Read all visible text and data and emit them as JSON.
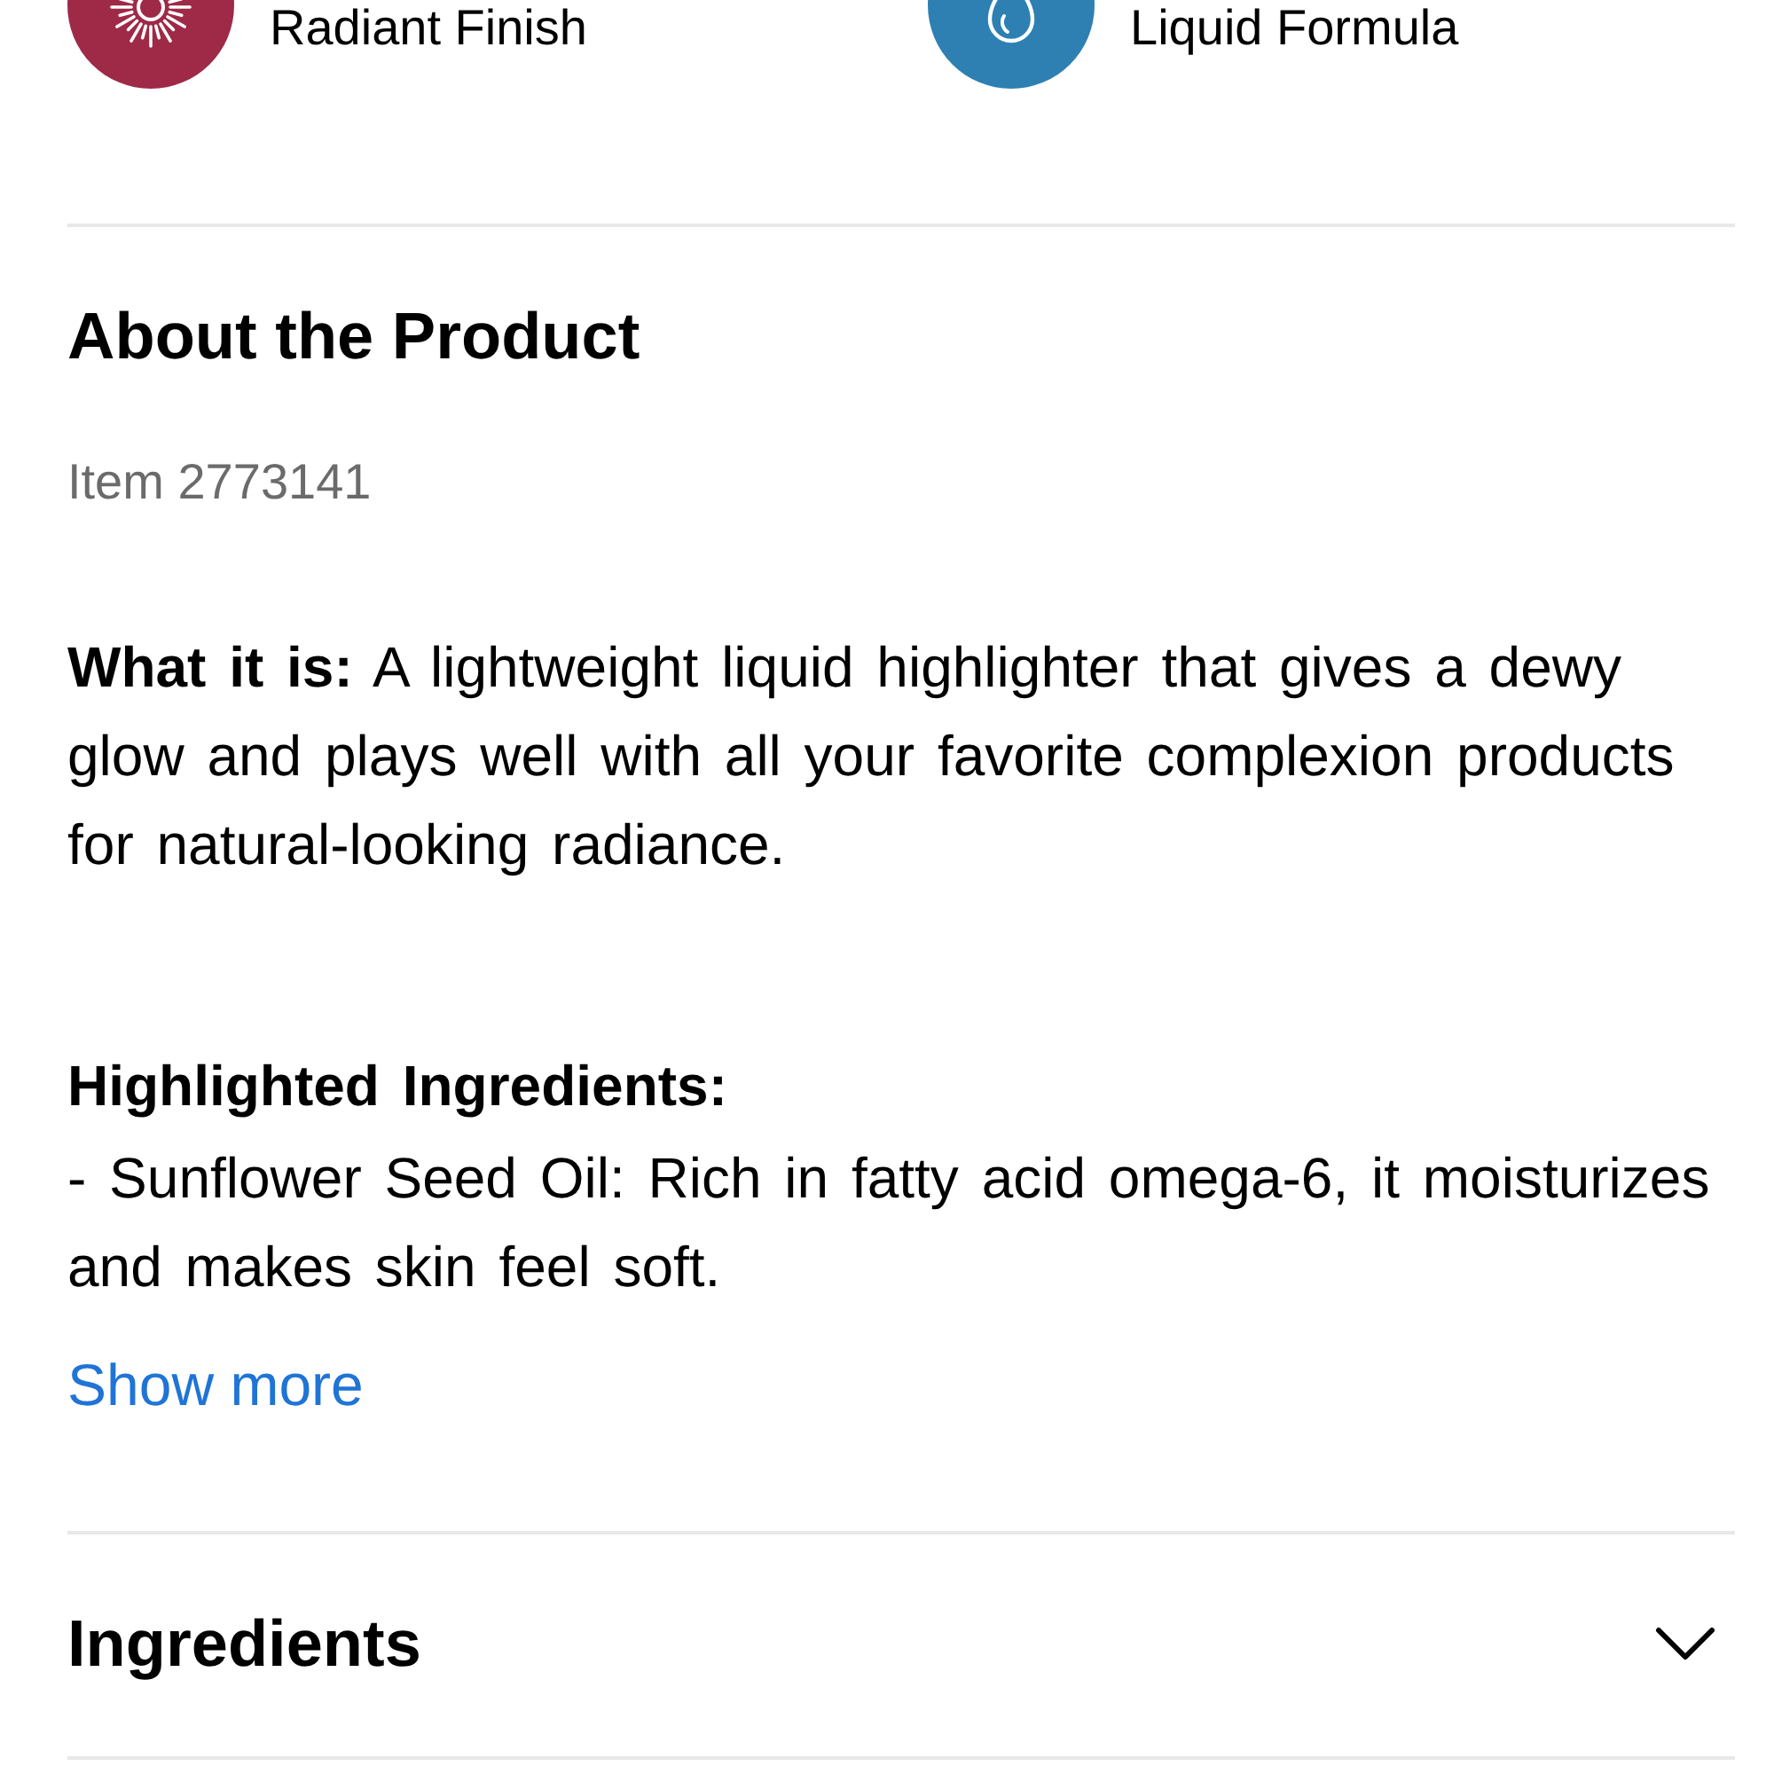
{
  "features": [
    {
      "kind": "finish",
      "label": "Radiant Finish",
      "color": "#9e2a47"
    },
    {
      "kind": "formula",
      "label": "Liquid Formula",
      "color": "#2e80b3"
    }
  ],
  "about": {
    "title": "About the Product",
    "item_number": "Item 2773141",
    "description": "**What it is:** A lightweight liquid highlighter that gives a dewy glow and plays well with all your favorite complexion products for natural-looking radiance.",
    "highlighted_ingredients": {
      "heading": "Highlighted Ingredients:",
      "items": [
        "- Sunflower Seed Oil: Rich in fatty acid omega-6, it moisturizes and makes skin feel soft."
      ]
    },
    "show_more": "Show more"
  },
  "ingredients": {
    "title": "Ingredients",
    "expanded": false
  }
}
